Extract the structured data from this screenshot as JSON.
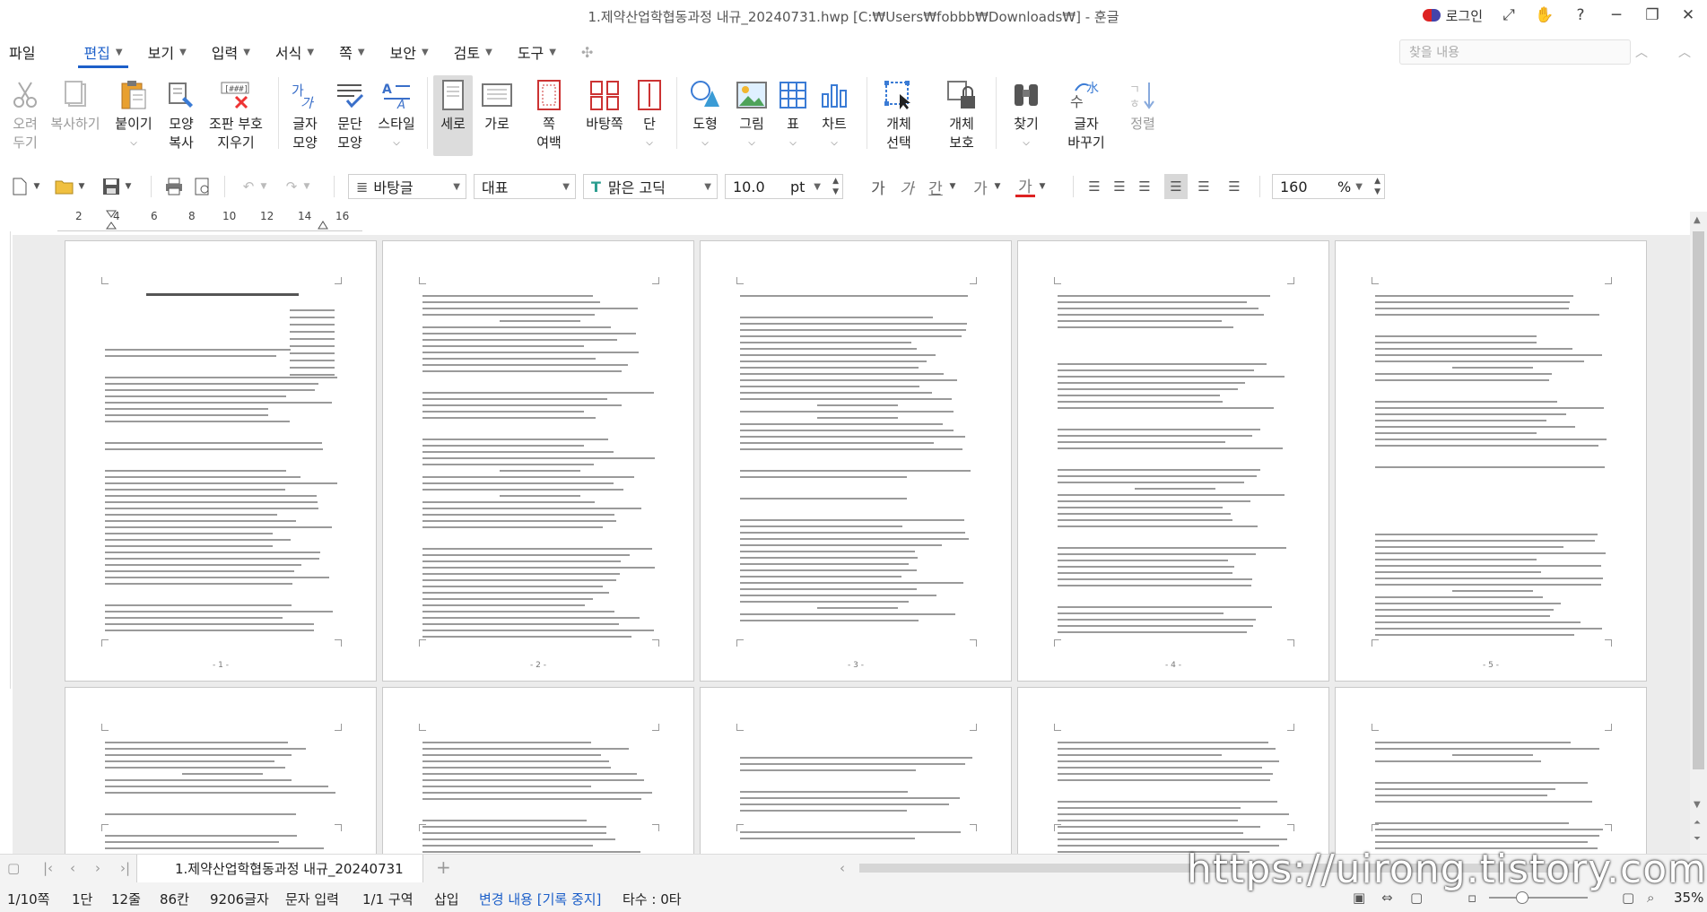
{
  "window": {
    "title": "1.제약산업학협동과정 내규_20240731.hwp [C:₩Users₩fobbb₩Downloads₩] - 훈글",
    "login_label": "로그인"
  },
  "menu": {
    "file": "파일",
    "items": [
      "편집",
      "보기",
      "입력",
      "서식",
      "쪽",
      "보안",
      "검토",
      "도구"
    ],
    "search_placeholder": "찾을 내용"
  },
  "ribbon": {
    "cut": [
      "오려",
      "두기"
    ],
    "copy": "복사하기",
    "paste": "붙이기",
    "format_copy": [
      "모양",
      "복사"
    ],
    "markup_erase": [
      "조판 부호",
      "지우기"
    ],
    "char_shape": [
      "글자",
      "모양"
    ],
    "para_shape": [
      "문단",
      "모양"
    ],
    "style": "스타일",
    "portrait": "세로",
    "landscape": "가로",
    "margin": [
      "쪽",
      "여백"
    ],
    "background": "바탕쪽",
    "columns": "단",
    "shape": "도형",
    "picture": "그림",
    "table": "표",
    "chart": "차트",
    "obj_select": [
      "개체",
      "선택"
    ],
    "obj_protect": [
      "개체",
      "보호"
    ],
    "find": "찾기",
    "replace_char": [
      "글자",
      "바꾸기"
    ],
    "sort": "정렬"
  },
  "toolbar2": {
    "style_value": "바탕글",
    "lang_value": "대표",
    "font_value": "맑은 고딕",
    "size_value": "10.0",
    "size_unit": "pt",
    "zoom_value": "160",
    "zoom_unit": "%"
  },
  "ruler": {
    "labels": [
      "2",
      "4",
      "6",
      "8",
      "10",
      "12",
      "14",
      "16"
    ]
  },
  "pages": {
    "numbers": [
      "- 1 -",
      "- 2 -",
      "- 3 -",
      "- 4 -",
      "- 5 -"
    ]
  },
  "tabs": {
    "doc_tab": "1.제약산업학협동과정 내규_20240731"
  },
  "status": {
    "page": "1/10쪽",
    "column": "1단",
    "line": "12줄",
    "col": "86칸",
    "chars": "9206글자",
    "mode": "문자 입력",
    "section": "1/1 구역",
    "insert": "삽입",
    "track": "변경 내용 [기록 중지]",
    "typing": "타수 : 0타",
    "zoom": "35%"
  },
  "watermark": "https://uirong.tistory.com",
  "colors": {
    "accent": "#1c5fc9"
  }
}
